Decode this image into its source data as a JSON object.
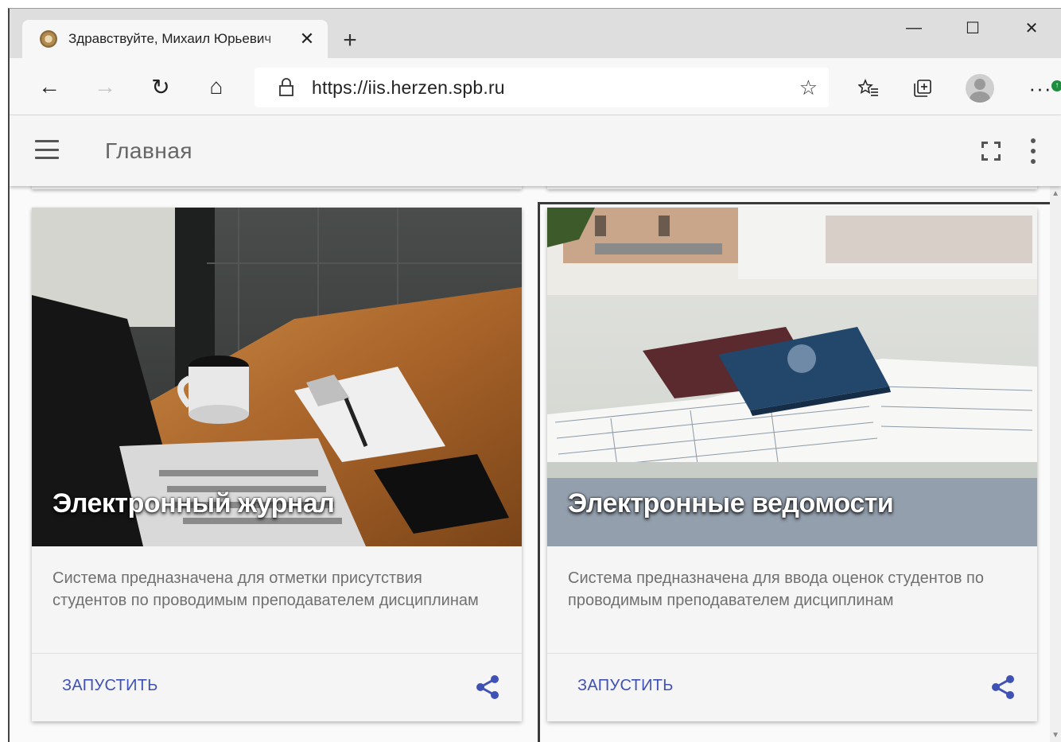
{
  "browser": {
    "tab_title": "Здравствуйте, Михаил Юрьевич",
    "tab_close": "✕",
    "new_tab": "+",
    "window_controls": {
      "minimize": "—",
      "maximize": "☐",
      "close": "✕"
    },
    "url_prefix": "https://",
    "url_host": "iis.herzen.spb.ru",
    "icons": [
      "back-icon",
      "forward-icon",
      "refresh-icon",
      "home-icon",
      "lock-icon",
      "favorite-star-icon",
      "favorites-icon",
      "collections-icon",
      "profile-icon",
      "more-icon"
    ],
    "glyphs": {
      "back": "←",
      "forward": "→",
      "refresh": "↻",
      "home": "⌂",
      "star": "☆",
      "favorites": "✩≡",
      "collections": "⧉",
      "more": "···",
      "update": "↑"
    }
  },
  "appbar": {
    "title": "Главная",
    "icons": [
      "menu-icon",
      "fullscreen-icon",
      "more-vert-icon"
    ]
  },
  "cards": [
    {
      "title": "Электронный журнал",
      "description": "Система предназначена для отметки присутствия студентов по проводимым преподавателем дисциплинам",
      "action": "ЗАПУСТИТЬ"
    },
    {
      "title": "Электронные ведомости",
      "description": "Система предназначена для ввода оценок студентов по проводимым преподавателем дисциплинам",
      "action": "ЗАПУСТИТЬ"
    }
  ],
  "colors": {
    "accent": "#3f51b5",
    "text_secondary": "#707070",
    "appbar_bg": "#f5f5f5",
    "tabstrip_bg": "#dedede"
  }
}
